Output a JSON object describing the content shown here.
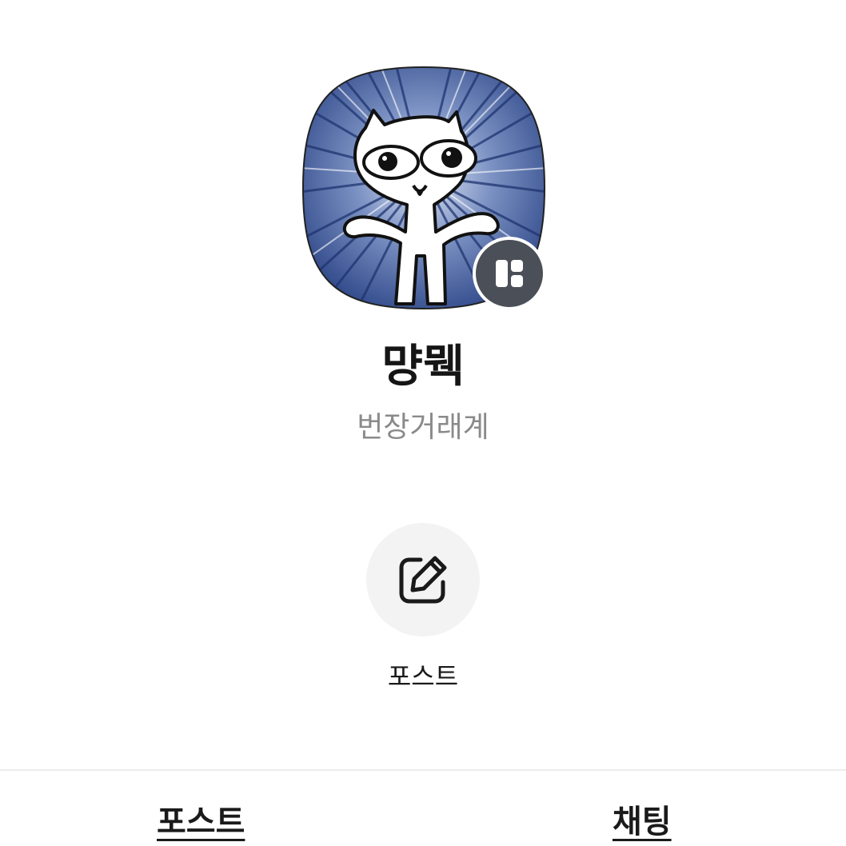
{
  "profile": {
    "name": "먕뭭",
    "description": "번장거래계",
    "avatar_icon": "cat-character-avatar",
    "badge_icon": "channel-badge-icon",
    "badge_color": "#4b4f57"
  },
  "actions": {
    "post": {
      "label": "포스트",
      "icon": "edit-icon"
    }
  },
  "tabs": [
    {
      "label": "포스트"
    },
    {
      "label": "채팅"
    }
  ],
  "colors": {
    "background": "#ffffff",
    "action_circle": "#f3f3f3",
    "secondary_text": "#8a8a8a",
    "avatar_blue": "#3d5a9c"
  }
}
